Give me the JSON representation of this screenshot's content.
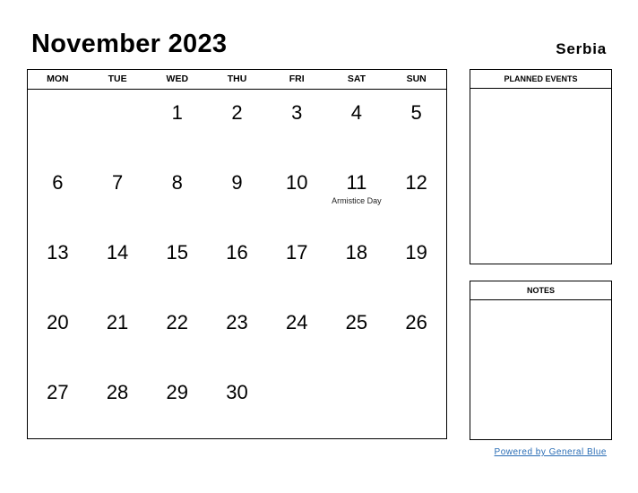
{
  "header": {
    "title": "November 2023",
    "country": "Serbia"
  },
  "calendar": {
    "weekdays": [
      "MON",
      "TUE",
      "WED",
      "THU",
      "FRI",
      "SAT",
      "SUN"
    ],
    "cells": [
      {
        "day": "",
        "holiday": ""
      },
      {
        "day": "",
        "holiday": ""
      },
      {
        "day": "1",
        "holiday": ""
      },
      {
        "day": "2",
        "holiday": ""
      },
      {
        "day": "3",
        "holiday": ""
      },
      {
        "day": "4",
        "holiday": ""
      },
      {
        "day": "5",
        "holiday": ""
      },
      {
        "day": "6",
        "holiday": ""
      },
      {
        "day": "7",
        "holiday": ""
      },
      {
        "day": "8",
        "holiday": ""
      },
      {
        "day": "9",
        "holiday": ""
      },
      {
        "day": "10",
        "holiday": ""
      },
      {
        "day": "11",
        "holiday": "Armistice Day"
      },
      {
        "day": "12",
        "holiday": ""
      },
      {
        "day": "13",
        "holiday": ""
      },
      {
        "day": "14",
        "holiday": ""
      },
      {
        "day": "15",
        "holiday": ""
      },
      {
        "day": "16",
        "holiday": ""
      },
      {
        "day": "17",
        "holiday": ""
      },
      {
        "day": "18",
        "holiday": ""
      },
      {
        "day": "19",
        "holiday": ""
      },
      {
        "day": "20",
        "holiday": ""
      },
      {
        "day": "21",
        "holiday": ""
      },
      {
        "day": "22",
        "holiday": ""
      },
      {
        "day": "23",
        "holiday": ""
      },
      {
        "day": "24",
        "holiday": ""
      },
      {
        "day": "25",
        "holiday": ""
      },
      {
        "day": "26",
        "holiday": ""
      },
      {
        "day": "27",
        "holiday": ""
      },
      {
        "day": "28",
        "holiday": ""
      },
      {
        "day": "29",
        "holiday": ""
      },
      {
        "day": "30",
        "holiday": ""
      },
      {
        "day": "",
        "holiday": ""
      },
      {
        "day": "",
        "holiday": ""
      },
      {
        "day": "",
        "holiday": ""
      }
    ]
  },
  "panels": {
    "planned_events": "PLANNED EVENTS",
    "notes": "NOTES"
  },
  "footer": {
    "powered_by": "Powered by General Blue",
    "link_color": "#2a6db5"
  }
}
